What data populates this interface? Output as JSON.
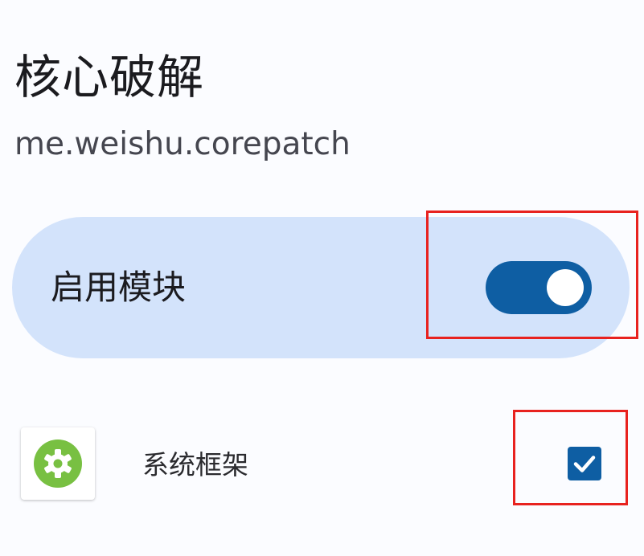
{
  "module": {
    "name": "核心破解",
    "package": "me.weishu.corepatch"
  },
  "enable": {
    "label": "启用模块",
    "checked": true
  },
  "scope": {
    "items": [
      {
        "label": "系统框架",
        "icon": "android-settings-gear-icon",
        "checked": true
      }
    ]
  },
  "colors": {
    "accent": "#0e5ea3",
    "card_bg": "#d3e3fb",
    "highlight": "#e8221f",
    "icon_green": "#78c042"
  }
}
